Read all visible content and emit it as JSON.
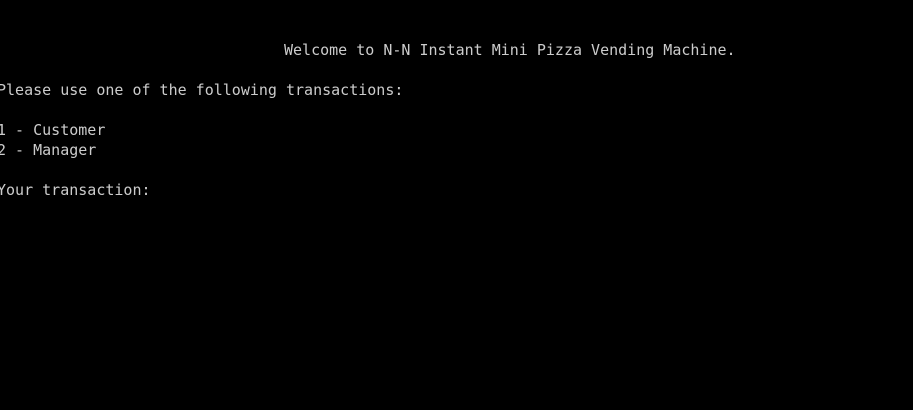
{
  "console": {
    "welcome": "Welcome to N-N Instant Mini Pizza Vending Machine.",
    "prompt": "Please use one of the following transactions:",
    "options": [
      {
        "label": "1 - Customer"
      },
      {
        "label": "2 - Manager"
      }
    ],
    "input_label": "Your transaction:",
    "input_value": ""
  },
  "colors": {
    "background": "#000000",
    "text": "#cccccc"
  }
}
